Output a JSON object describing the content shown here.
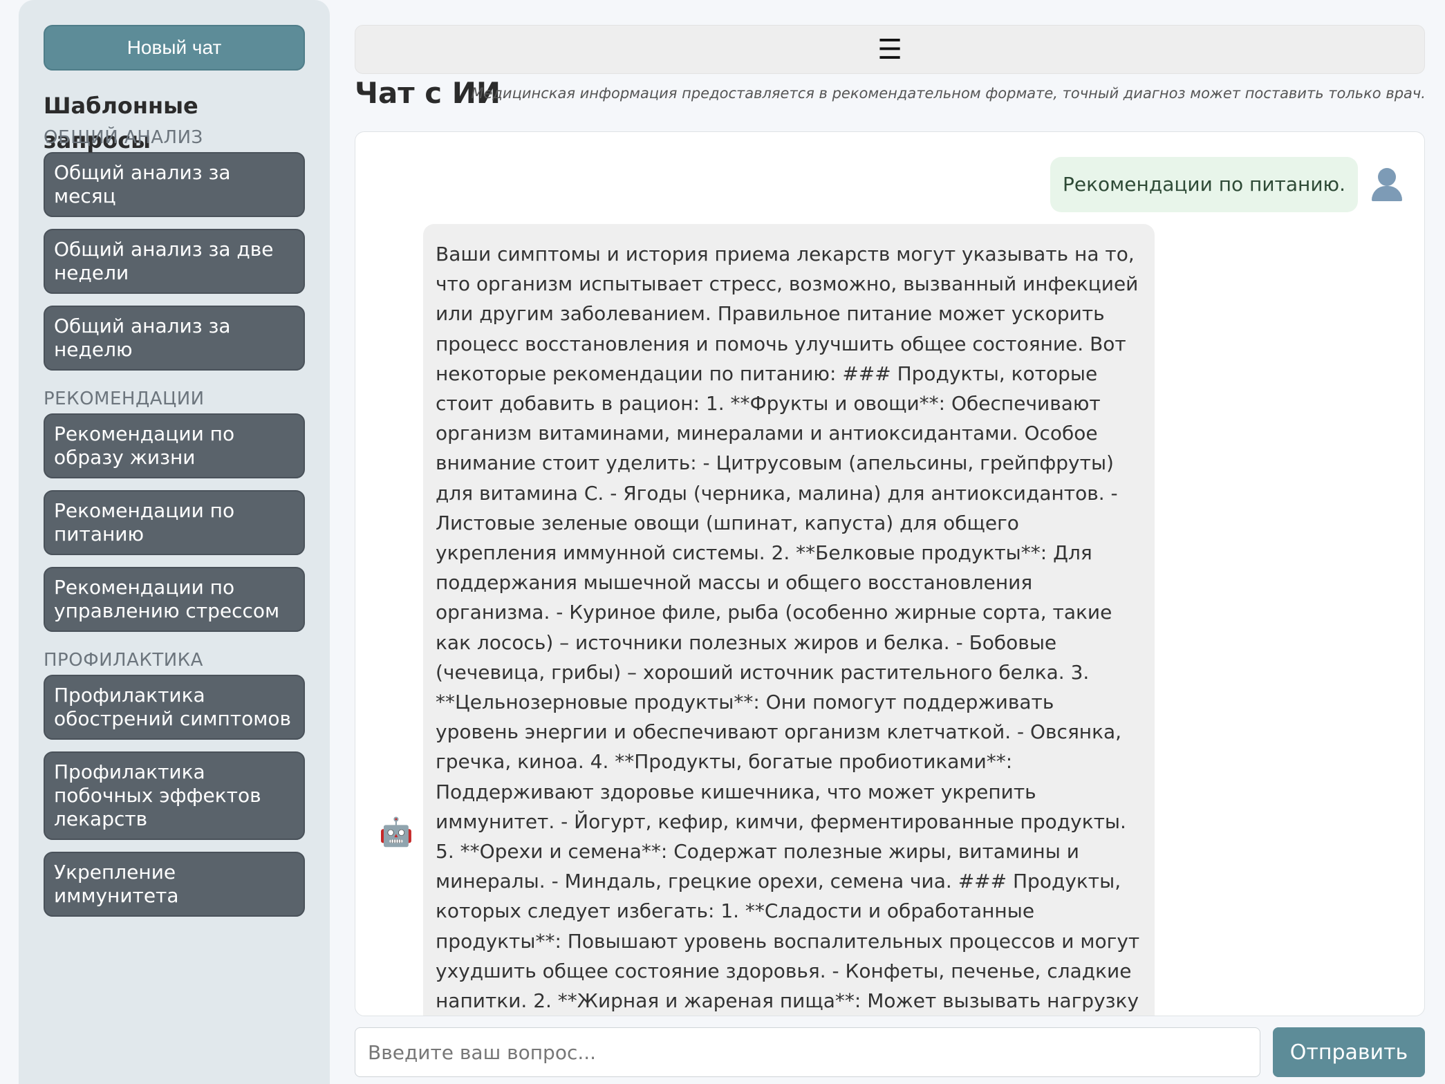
{
  "sidebar": {
    "new_chat_label": "Новый чат",
    "title": "Шаблонные запросы",
    "sections": [
      {
        "label": "ОБЩИЙ АНАЛИЗ",
        "items": [
          "Общий анализ за месяц",
          "Общий анализ за две недели",
          "Общий анализ за неделю"
        ]
      },
      {
        "label": "РЕКОМЕНДАЦИИ",
        "items": [
          "Рекомендации по образу жизни",
          "Рекомендации по питанию",
          "Рекомендации по управлению стрессом"
        ]
      },
      {
        "label": "ПРОФИЛАКТИКА",
        "items": [
          "Профилактика обострений симптомов",
          "Профилактика побочных эффектов лекарств",
          "Укрепление иммунитета"
        ]
      }
    ]
  },
  "header": {
    "menu_icon": "hamburger-icon",
    "menu_glyph": "☰"
  },
  "chat": {
    "title": "Чат с ИИ",
    "disclaimer": "Медицинская информация предоставляется в рекомендательном формате, точный диагноз может поставить только врач.",
    "messages": [
      {
        "role": "user",
        "text": "Рекомендации по питанию.",
        "avatar_icon": "user-icon"
      },
      {
        "role": "assistant",
        "avatar_icon": "robot-icon",
        "avatar_glyph": "🤖",
        "text": "Ваши симптомы и история приема лекарств могут указывать на то, что организм испытывает стресс, возможно, вызванный инфекцией или другим заболеванием. Правильное питание может ускорить процесс восстановления и помочь улучшить общее состояние. Вот некоторые рекомендации по питанию: ### Продукты, которые стоит добавить в рацион: 1. **Фрукты и овощи**: Обеспечивают организм витаминами, минералами и антиоксидантами. Особое внимание стоит уделить: - Цитрусовым (апельсины, грейпфруты) для витамина C. - Ягоды (черника, малина) для антиоксидантов. - Листовые зеленые овощи (шпинат, капуста) для общего укрепления иммунной системы. 2. **Белковые продукты**: Для поддержания мышечной массы и общего восстановления организма. - Куриное филе, рыба (особенно жирные сорта, такие как лосось) – источники полезных жиров и белка. - Бобовые (чечевица, грибы) – хороший источник растительного белка. 3. **Цельнозерновые продукты**: Они помогут поддерживать уровень энергии и обеспечивают организм клетчаткой. - Овсянка, гречка, киноа. 4. **Продукты, богатые пробиотиками**: Поддерживают здоровье кишечника, что может укрепить иммунитет. - Йогурт, кефир, кимчи, ферментированные продукты. 5. **Орехи и семена**: Содержат полезные жиры, витамины и минералы. - Миндаль, грецкие орехи, семена чиа. ### Продукты, которых следует избегать: 1. **Сладости и обработанные продукты**: Повышают уровень воспалительных процессов и могут ухудшить общее состояние здоровья. - Конфеты, печенье, сладкие напитки. 2. **Жирная и жареная пища**: Может вызывать нагрузку на печень и замедлять процесс восстановления. - Фастфуд, чипсы, жирное мясо. 3. **Алкоголь и кофеин**: Может ухудшать"
      }
    ]
  },
  "composer": {
    "placeholder": "Введите ваш вопрос...",
    "value": "",
    "send_label": "Отправить"
  },
  "colors": {
    "accent": "#5d8c98",
    "template_button": "#5a636b",
    "sidebar_bg": "#e1e8ec",
    "user_bubble": "#e8f5ea",
    "bot_bubble": "#efefef"
  }
}
